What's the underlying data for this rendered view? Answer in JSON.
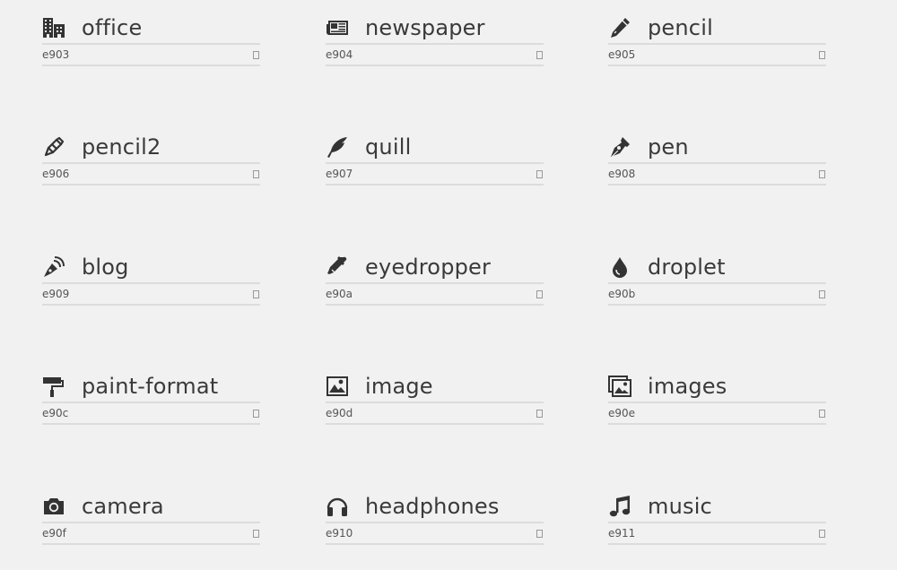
{
  "icons": [
    {
      "name": "office",
      "code": "e903",
      "icon": "office-icon"
    },
    {
      "name": "newspaper",
      "code": "e904",
      "icon": "newspaper-icon"
    },
    {
      "name": "pencil",
      "code": "e905",
      "icon": "pencil-icon"
    },
    {
      "name": "pencil2",
      "code": "e906",
      "icon": "pencil2-icon"
    },
    {
      "name": "quill",
      "code": "e907",
      "icon": "quill-icon"
    },
    {
      "name": "pen",
      "code": "e908",
      "icon": "pen-icon"
    },
    {
      "name": "blog",
      "code": "e909",
      "icon": "blog-icon"
    },
    {
      "name": "eyedropper",
      "code": "e90a",
      "icon": "eyedropper-icon"
    },
    {
      "name": "droplet",
      "code": "e90b",
      "icon": "droplet-icon"
    },
    {
      "name": "paint-format",
      "code": "e90c",
      "icon": "paint-format-icon"
    },
    {
      "name": "image",
      "code": "e90d",
      "icon": "image-icon"
    },
    {
      "name": "images",
      "code": "e90e",
      "icon": "images-icon"
    },
    {
      "name": "camera",
      "code": "e90f",
      "icon": "camera-icon"
    },
    {
      "name": "headphones",
      "code": "e910",
      "icon": "headphones-icon"
    },
    {
      "name": "music",
      "code": "e911",
      "icon": "music-icon"
    }
  ]
}
